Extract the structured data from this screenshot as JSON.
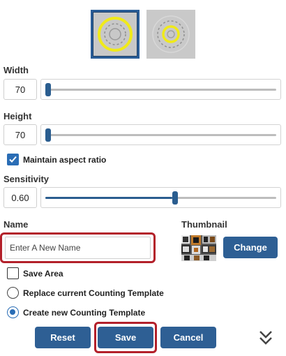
{
  "templates": {
    "items": [
      {
        "name": "template-option-selected",
        "selected": true
      },
      {
        "name": "template-option-alternate",
        "selected": false
      }
    ]
  },
  "width": {
    "label": "Width",
    "value": "70",
    "slider_fraction": 0.0
  },
  "height": {
    "label": "Height",
    "value": "70",
    "slider_fraction": 0.0
  },
  "aspect": {
    "label": "Maintain aspect ratio",
    "checked": true
  },
  "sensitivity": {
    "label": "Sensitivity",
    "value": "0.60",
    "slider_fraction": 0.55
  },
  "name_section": {
    "label": "Name",
    "placeholder": "Enter A New Name",
    "value": ""
  },
  "thumbnail": {
    "label": "Thumbnail",
    "change_label": "Change"
  },
  "save_area": {
    "label": "Save Area",
    "checked": false
  },
  "mode": {
    "options": [
      {
        "label": "Replace current Counting Template",
        "selected": false
      },
      {
        "label": "Create new Counting Template",
        "selected": true
      }
    ]
  },
  "actions": {
    "reset_label": "Reset",
    "save_label": "Save",
    "cancel_label": "Cancel",
    "collapse_icon": "double-chevron-down-icon"
  },
  "colors": {
    "accent": "#2e5f94",
    "highlight": "#b3202a",
    "ring": "#f0ea1a",
    "check": "#2a6db5"
  }
}
